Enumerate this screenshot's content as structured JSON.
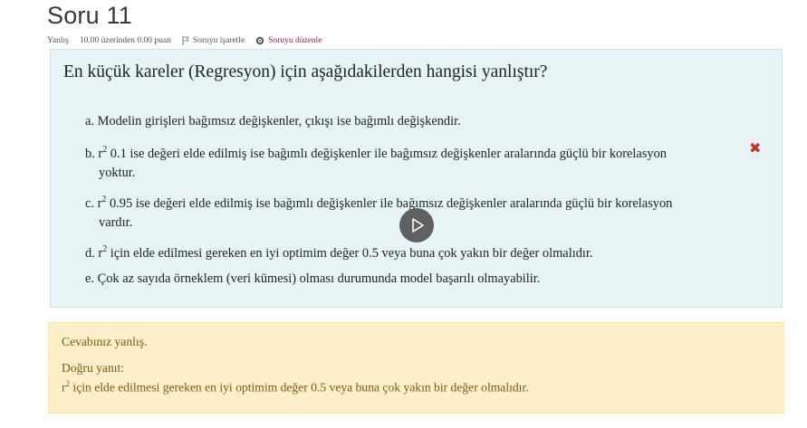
{
  "question": {
    "title": "Soru 11",
    "status": "Yanlış",
    "grade": "10.00 üzerinden 0.00 puan",
    "flag_label": "Soruyu işaretle",
    "edit_label": "Soruyu düzenle",
    "text": "En küçük kareler (Regresyon) için aşağıdakilerden hangisi yanlıştır?"
  },
  "answers": [
    {
      "prefix": "a.",
      "line1": "Modelin girişleri bağımsız değişkenler, çıkışı ise bağımlı değişkendir.",
      "line2": ""
    },
    {
      "prefix": "b. r",
      "sup": "2",
      "line1": " 0.1 ise değeri elde edilmiş ise bağımlı değişkenler ile bağımsız değişkenler aralarında güçlü bir korelasyon",
      "line2": "yoktur."
    },
    {
      "prefix": "c. r",
      "sup": "2",
      "line1": " 0.95 ise değeri elde edilmiş ise bağımlı değişkenler ile bağımsız değişkenler aralarında güçlü bir korelasyon",
      "line2": "vardır."
    },
    {
      "prefix": "d. r",
      "sup": "2",
      "line1": " için elde edilmesi gereken en iyi optimim değer 0.5 veya buna çok yakın bir değer olmalıdır.",
      "line2": ""
    },
    {
      "prefix": "e.",
      "line1": "Çok az sayıda örneklem (veri kümesi) olması durumunda model başarılı olmayabilir.",
      "line2": ""
    }
  ],
  "feedback": {
    "result": "Cevabınız yanlış.",
    "correct_label": "Doğru yanıt:",
    "correct_prefix": "r",
    "correct_sup": "2",
    "correct_text": " için elde edilmesi gereken en iyi optimim değer 0.5 veya buna çok yakın bir değer olmalıdır."
  },
  "icons": {
    "wrong": "cross-icon",
    "play": "play-icon"
  },
  "colors": {
    "question_bg": "#e7f3f5",
    "feedback_bg": "#fcefc9",
    "feedback_text": "#7d5a0f",
    "wrong_mark": "#ca3120",
    "edit_link": "#a2243c"
  }
}
